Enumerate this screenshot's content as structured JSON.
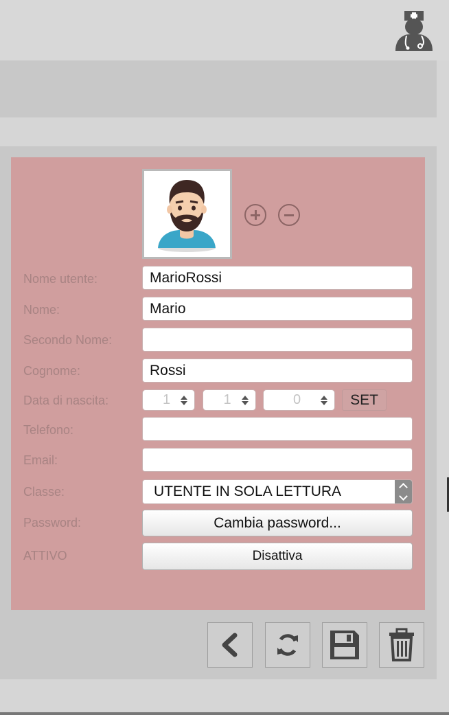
{
  "header": {
    "profile_icon": "doctor-avatar-icon"
  },
  "avatar": {
    "image_icon": "bearded-man-avatar",
    "add_icon": "plus-circle-icon",
    "remove_icon": "minus-circle-icon"
  },
  "form": {
    "username": {
      "label": "Nome utente:",
      "value": "MarioRossi"
    },
    "first_name": {
      "label": "Nome:",
      "value": "Mario"
    },
    "middle_name": {
      "label": "Secondo Nome:",
      "value": ""
    },
    "last_name": {
      "label": "Cognome:",
      "value": "Rossi"
    },
    "birth_date": {
      "label": "Data di nascita:",
      "day": "1",
      "month": "1",
      "year": "0",
      "set_label": "SET"
    },
    "phone": {
      "label": "Telefono:",
      "value": ""
    },
    "email": {
      "label": "Email:",
      "value": ""
    },
    "user_class": {
      "label": "Classe:",
      "selected": "UTENTE IN SOLA LETTURA"
    },
    "password": {
      "label": "Password:",
      "button": "Cambia password..."
    },
    "active": {
      "label": "ATTIVO",
      "button": "Disattiva"
    }
  },
  "toolbar": {
    "back_icon": "chevron-left-icon",
    "refresh_icon": "refresh-icon",
    "save_icon": "floppy-disk-icon",
    "delete_icon": "trash-icon"
  },
  "colors": {
    "form_background": "#d09e9e",
    "panel_background": "#c8c8c8",
    "label_text": "#a88383"
  }
}
